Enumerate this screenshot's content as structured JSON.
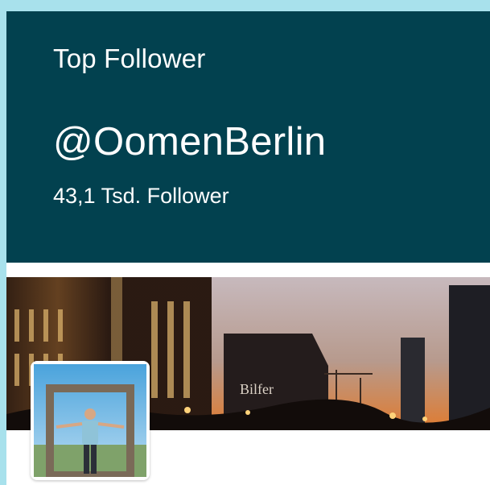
{
  "card": {
    "label": "Top Follower",
    "handle": "@OomenBerlin",
    "follower_count": "43,1 Tsd. Follower"
  },
  "colors": {
    "page_background": "#a8e1ec",
    "header_background": "#02414f",
    "header_text": "#ffffff"
  }
}
